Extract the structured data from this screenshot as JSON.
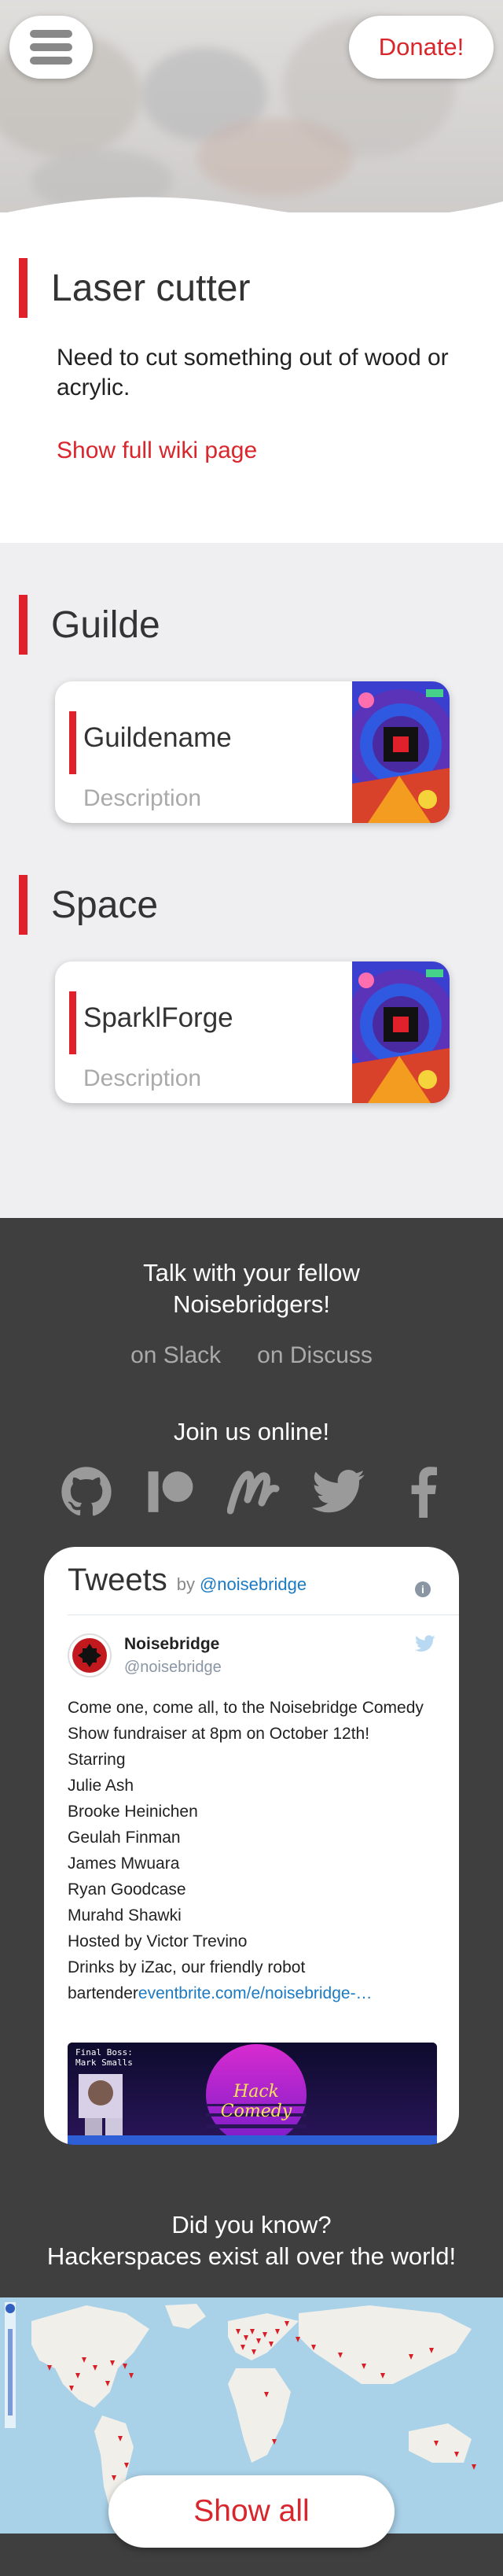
{
  "header": {
    "menu_icon": "hamburger-icon",
    "donate_label": "Donate!"
  },
  "laser": {
    "title": "Laser cutter",
    "description": "Need to cut something out of wood or acrylic.",
    "wiki_link": "Show full wiki page"
  },
  "guilde": {
    "title": "Guilde",
    "card": {
      "name": "Guildename",
      "description": "Description"
    }
  },
  "space": {
    "title": "Space",
    "card": {
      "name": "SparklForge",
      "description": "Description"
    }
  },
  "footer": {
    "talk_line1": "Talk with your fellow",
    "talk_line2": "Noisebridgers!",
    "chat_links": [
      "on Slack",
      "on Discuss"
    ],
    "join_text": "Join us online!",
    "social_icons": [
      "github-icon",
      "patreon-icon",
      "meetup-icon",
      "twitter-icon",
      "facebook-icon"
    ],
    "did_you_know_line1": "Did you know?",
    "did_you_know_line2": "Hackerspaces exist all over the world!",
    "show_all_label": "Show all"
  },
  "tweets": {
    "title": "Tweets",
    "by": "by",
    "handle": "@noisebridge",
    "tweet": {
      "author": "Noisebridge",
      "screen_name": "@noisebridge",
      "lines": [
        "Come one, come all, to the Noisebridge Comedy",
        "Show fundraiser at 8pm on October 12th!",
        "Starring",
        "Julie Ash",
        "Brooke Heinichen",
        "Geulah Finman",
        "James Mwuara",
        "Ryan Goodcase",
        "Murahd Shawki",
        "Hosted by Victor Trevino",
        "Drinks by iZac, our friendly robot"
      ],
      "last_line_text": "bartender",
      "last_line_link": "eventbrite.com/e/noisebridge-…",
      "media_title": "Hack Comedy",
      "media_left": "Final Boss:\nMark Smalls"
    }
  },
  "colors": {
    "accent": "#e0202a",
    "dark_bg": "#3f3f3f",
    "link": "#1b7ac2"
  }
}
